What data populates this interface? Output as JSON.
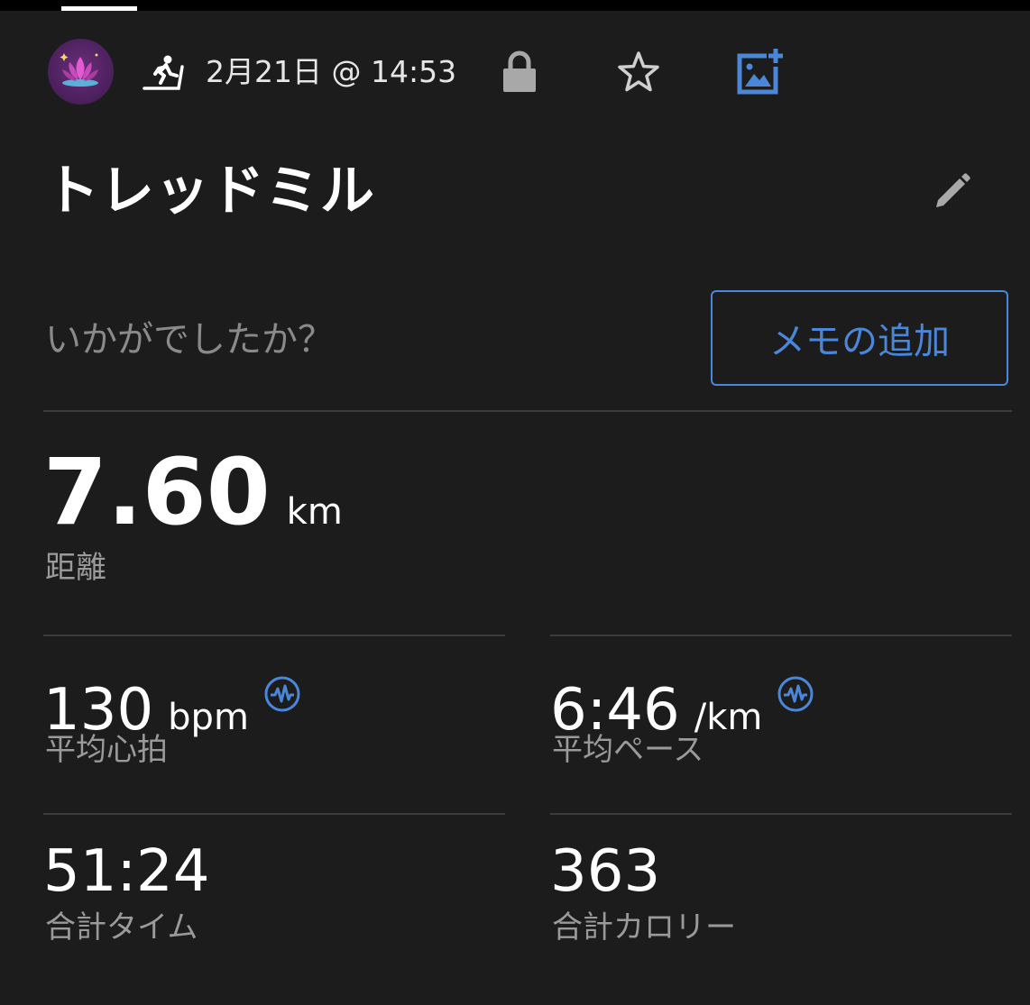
{
  "header": {
    "date": "2月21日 @ 14:53",
    "icons": {
      "avatar": "lotus-avatar",
      "activity": "treadmill-runner-icon",
      "privacy": "lock-icon",
      "favorite": "star-icon",
      "add_photo": "add-photo-icon"
    }
  },
  "activity": {
    "title": "トレッドミル"
  },
  "notes": {
    "prompt": "いかがでしたか？",
    "add_memo_label": "メモの追加"
  },
  "stats": {
    "distance": {
      "value": "7.60",
      "unit": "km",
      "label": "距離"
    },
    "avg_hr": {
      "value": "130",
      "unit": "bpm",
      "label": "平均心拍"
    },
    "avg_pace": {
      "value": "6:46",
      "unit": "/km",
      "label": "平均ペース"
    },
    "total_time": {
      "value": "51:24",
      "label": "合計タイム"
    },
    "total_calories": {
      "value": "363",
      "label": "合計カロリー"
    }
  },
  "colors": {
    "background": "#1c1c1c",
    "accent": "#4a87d9",
    "divider": "#3c3c3c",
    "muted_text": "#9a9a9a"
  }
}
